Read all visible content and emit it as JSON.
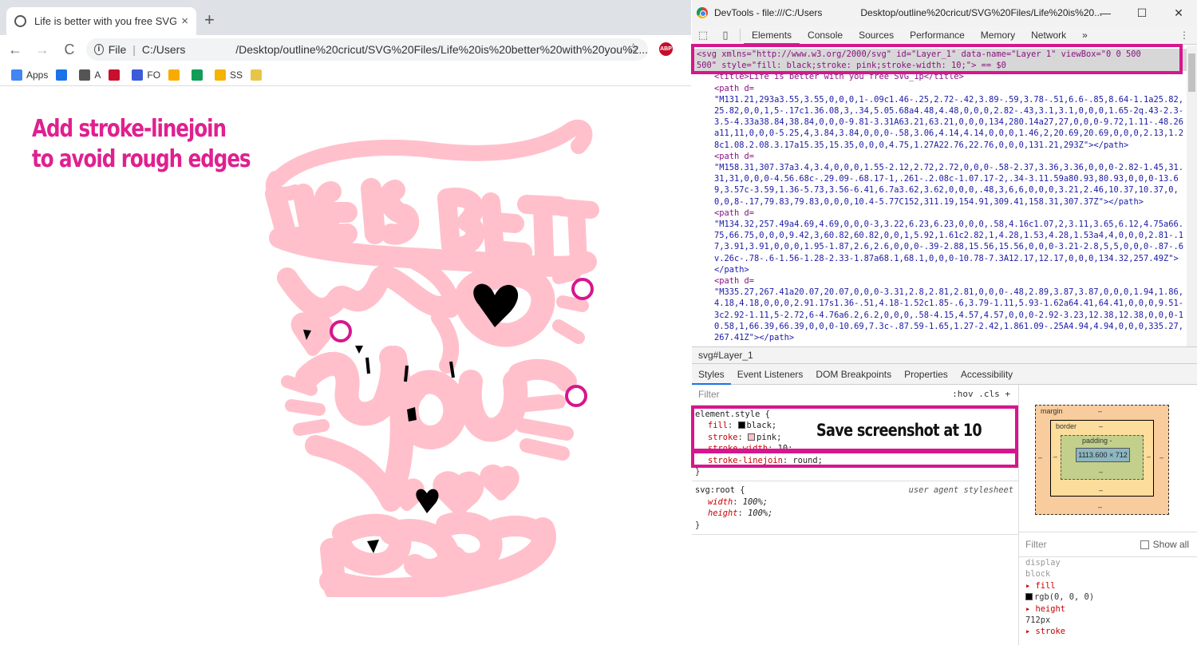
{
  "browser": {
    "tab_title": "Life is better with you free SVG_1",
    "tab_close": "×",
    "new_tab": "+",
    "nav": {
      "back": "←",
      "forward": "→",
      "reload": "C"
    },
    "address": {
      "scheme": "File",
      "path_start": "C:/Users",
      "path_end": "/Desktop/outline%20cricut/SVG%20Files/Life%20is%20better%20with%20you%2..."
    },
    "star": "☆",
    "abp": "ABP",
    "bookmarks": [
      {
        "label": "Apps",
        "icon": "apps-grid-icon",
        "color": "#4285f4"
      },
      {
        "label": "",
        "icon": "grid-icon",
        "color": "#1a73e8"
      },
      {
        "label": "A",
        "icon": "globe-icon",
        "color": "#555555"
      },
      {
        "label": "",
        "icon": "colorado-icon",
        "color": "#c8102e"
      },
      {
        "label": "FO",
        "icon": "fo-icon",
        "color": "#3b5bdb"
      },
      {
        "label": "",
        "icon": "analytics-icon",
        "color": "#f9ab00"
      },
      {
        "label": "",
        "icon": "chat-icon",
        "color": "#0f9d58"
      },
      {
        "label": "SS",
        "icon": "star-icon",
        "color": "#f4b400"
      },
      {
        "label": "",
        "icon": "sparkle-icon",
        "color": "#e8c547"
      }
    ]
  },
  "page": {
    "annotation_line1": "Add stroke-linejoin",
    "annotation_line2": "to avoid rough edges",
    "art_fill": "#000000",
    "art_stroke": "#ffc0cb"
  },
  "devtools": {
    "title_left": "DevTools - file:///C:/Users",
    "title_right": "Desktop/outline%20cricut/SVG%20Files/Life%20is%20...",
    "window_controls": [
      "—",
      "☐",
      "✕"
    ],
    "tabs": [
      "Elements",
      "Console",
      "Sources",
      "Performance",
      "Memory",
      "Network"
    ],
    "more_tabs": "»",
    "menu": "⋮",
    "elements": {
      "svg_line1": "<svg xmlns=\"http://www.w3.org/2000/svg\" id=\"Layer_1\" data-name=\"Layer 1\" viewBox=\"0 0 500",
      "svg_line2": "500\" style=\"fill: black;stroke: pink;stroke-width: 10;\"> == $0",
      "title_line": "<title>Life is better with you free SVG_1p</title>",
      "paths": [
        {
          "open": "<path d=",
          "d": "\"M131.21,293a3.55,3.55,0,0,0,1-.09c1.46-.25,2.72-.42,3.89-.59,3.78-.51,6.6-.85,8.64-1.1a25.82,25.82,0,0,1,5-.17c1.36.08,3,.34,5.05.68a4.48,4.48,0,0,0,2.82-.43,3.1,3.1,0,0,0,1.65-2q.43-2.3-3.5-4.33a38.84,38.84,0,0,0-9.81-3.31A63.21,63.21,0,0,0,134,280.14a27,27,0,0,0-9.72,1.11-.48.26a11,11,0,0,0-5.25,4,3.84,3.84,0,0,0-.58,3.06,4.14,4.14,0,0,0,1.46,2,20.69,20.69,0,0,0,2.13,1.28c1.08.2.08.3.17a15.35,15.35,0,0,0,4.75,1.27A22.76,22.76,0,0,0,131.21,293Z\"></path>"
        },
        {
          "open": "<path d=",
          "d": "\"M158.31,307.37a3.4,3.4,0,0,0,1.55-2.12,2.72,2.72,0,0,0-.58-2.37,3.36,3.36,0,0,0-2.82-1.45,31.31,31,0,0,0-4.56.68c-.29.09-.68.17-1,.261-.2.08c-1.07.17-2,.34-3.11.59a80.93,80.93,0,0,0-13.69,3.57c-3.59,1.36-5.73,3.56-6.41,6.7a3.62,3.62,0,0,0,.48,3,6,6,0,0,0,3.21,2.46,10.37,10.37,0,0,0,8-.17,79.83,79.83,0,0,0,10.4-5.77C152,311.19,154.91,309.41,158.31,307.37Z\"></path>"
        },
        {
          "open": "<path d=",
          "d": "\"M134.32,257.49a4.69,4.69,0,0,0-3,3.22,6.23,6.23,0,0,0,.58,4.16c1.07,2,3.11,3.65,6.12,4.75a66.75,66.75,0,0,0,9.42,3,60.82,60.82,0,0,1,5.92,1.61c2.82,1,4.28,1.53,4.28,1.53a4,4,0,0,0,2.81-.17,3.91,3.91,0,0,0,1.95-1.87,2.6,2.6,0,0,0-.39-2.88,15.56,15.56,0,0,0-3.21-2.8,5,5,0,0,0-.87-.6v.26c-.78-.6-1.56-1.28-2.33-1.87a68.1,68.1,0,0,0-10.78-7.3A12.17,12.17,0,0,0,134.32,257.49Z\"></path>"
        },
        {
          "open": "<path d=",
          "d": "\"M335.27,267.41a20.07,20.07,0,0,0-3.31,2.8,2.81,2.81,0,0,0-.48,2.89,3.87,3.87,0,0,0,1.94,1.86,4.18,4.18,0,0,0,2.91.17s1.36-.51,4.18-1.52c1.85-.6,3.79-1.11,5.93-1.62a64.41,64.41,0,0,0,9.51-3c2.92-1.11,5-2.72,6-4.76a6.2,6.2,0,0,0,.58-4.15,4.57,4.57,0,0,0-2.92-3.23,12.38,12.38,0,0,0-10.58,1,66.39,66.39,0,0,0-10.69,7.3c-.87.59-1.65,1.27-2.42,1.861.09-.25A4.94,4.94,0,0,0,335.27,267.41Z\"></path>"
        }
      ]
    },
    "breadcrumb": "svg#Layer_1",
    "subtabs": [
      "Styles",
      "Event Listeners",
      "DOM Breakpoints",
      "Properties",
      "Accessibility"
    ],
    "styles": {
      "filter_placeholder": "Filter",
      "filter_tools": ":hov  .cls  +",
      "element_style_selector": "element.style {",
      "props": [
        {
          "name": "fill",
          "value": "black;",
          "swatch": "#000000"
        },
        {
          "name": "stroke",
          "value": "pink;",
          "swatch": "#ffc0cb"
        },
        {
          "name": "stroke-width",
          "value": "10;",
          "swatch": ""
        },
        {
          "name": "stroke-linejoin",
          "value": "round;",
          "swatch": ""
        }
      ],
      "close_brace": "}",
      "ua_selector": "svg:root {",
      "ua_source": "user agent stylesheet",
      "ua_props": [
        {
          "name": "width",
          "value": "100%;"
        },
        {
          "name": "height",
          "value": "100%;"
        }
      ]
    },
    "boxmodel": {
      "margin": "margin",
      "border": "border",
      "padding": "padding -",
      "content": "1113.600 × 712",
      "dash": "–"
    },
    "computed": {
      "filter_placeholder": "Filter",
      "show_all": "Show all",
      "props": [
        {
          "name": "display",
          "value": "block",
          "dim": true
        },
        {
          "name": "fill",
          "value": "rgb(0, 0, 0)",
          "dim": false
        },
        {
          "name": "height",
          "value": "712px",
          "dim": false
        },
        {
          "name": "stroke",
          "value": "",
          "dim": false
        }
      ]
    },
    "annotation_note": "Save screenshot at 10"
  },
  "colors": {
    "accent": "#d6168e",
    "annotation_text": "#e0208f"
  }
}
